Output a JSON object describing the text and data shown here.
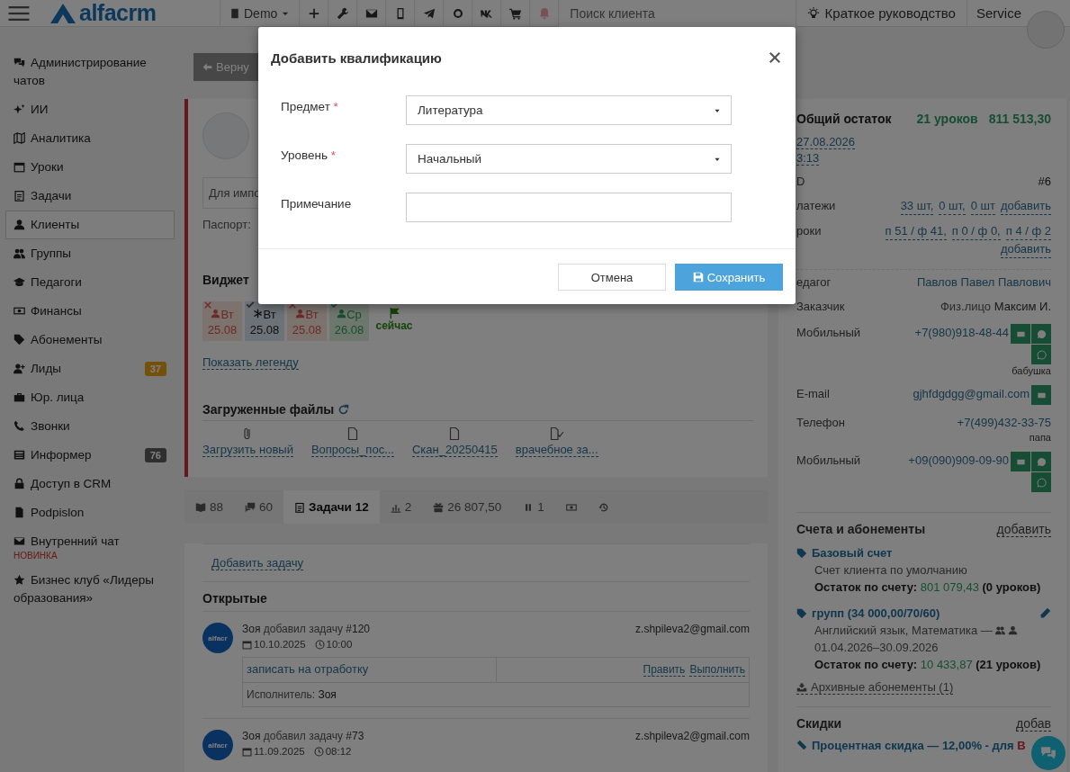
{
  "topbar": {
    "logo": "alfacrm",
    "branch": "Demo",
    "search_placeholder": "Поиск клиента",
    "guide": "Краткое руководство",
    "user": "Service"
  },
  "sidebar": [
    {
      "label": "Администрирование чатов",
      "selected": false
    },
    {
      "label": "ИИ",
      "selected": false
    },
    {
      "label": "Аналитика",
      "selected": false
    },
    {
      "label": "Уроки",
      "selected": false
    },
    {
      "label": "Задачи",
      "selected": false
    },
    {
      "label": "Клиенты",
      "selected": true
    },
    {
      "label": "Группы",
      "selected": false
    },
    {
      "label": "Педагоги",
      "selected": false
    },
    {
      "label": "Финансы",
      "selected": false
    },
    {
      "label": "Абонементы",
      "selected": false
    },
    {
      "label": "Лиды",
      "selected": false,
      "badge": {
        "text": "37",
        "kind": "warning"
      }
    },
    {
      "label": "Юр. лица",
      "selected": false
    },
    {
      "label": "Звонки",
      "selected": false
    },
    {
      "label": "Информер",
      "selected": false,
      "badge": {
        "text": "76",
        "kind": "default"
      }
    },
    {
      "label": "Доступ в CRM",
      "selected": false
    },
    {
      "label": "Podpislon",
      "selected": false
    },
    {
      "label": "Внутренний чат",
      "selected": false,
      "note": "НОВИНКА"
    },
    {
      "label": "Бизнес клуб «Лидеры образования»",
      "selected": false
    }
  ],
  "back_button": "Верну",
  "client_card": {
    "note_fragment": "Для импо",
    "passport_fragment": "Паспорт:",
    "widget_title_fragment": "Виджет",
    "lessons": [
      {
        "kind": "cancelled",
        "day": "Вт",
        "date": "25.08"
      },
      {
        "kind": "planned",
        "day": "Вт",
        "date": "25.08"
      },
      {
        "kind": "cancelled",
        "day": "Вт",
        "date": "25.08"
      },
      {
        "kind": "attended",
        "day": "Ср",
        "date": "26.08"
      }
    ],
    "now_label": "сейчас",
    "legend_link": "Показать легенду",
    "files_title": "Загруженные файлы",
    "files": [
      {
        "kind": "upload",
        "name": "Загрузить новый"
      },
      {
        "kind": "file",
        "name": "Вопросы_пос..."
      },
      {
        "kind": "file",
        "name": "Скан_20250415"
      },
      {
        "kind": "signed",
        "name": "врачебное за..."
      }
    ]
  },
  "tabs": [
    {
      "kind": "book",
      "label": "88",
      "selected": false
    },
    {
      "kind": "comments",
      "label": "60",
      "selected": false
    },
    {
      "kind": "tasks",
      "label": "Задачи 12",
      "selected": true
    },
    {
      "kind": "chart",
      "label": "2",
      "selected": false
    },
    {
      "kind": "gift",
      "label": "26 807,50",
      "selected": false
    },
    {
      "kind": "pause",
      "label": "1",
      "selected": false
    },
    {
      "kind": "money",
      "selected": false
    },
    {
      "kind": "history",
      "selected": false
    }
  ],
  "tasks": {
    "add_link": "Добавить задачу",
    "open_title": "Открытые",
    "items": [
      {
        "avatar_label": "alfacr",
        "author": "Зоя",
        "action": "добавил задачу",
        "number": "#120",
        "email": "z.shpileva2@gmail.com",
        "date": "10.10.2025",
        "time": "10:00",
        "text": "записать на отработку",
        "edit": "Править",
        "complete": "Выполнить",
        "assignee_label": "Исполнитель:",
        "assignee": "Зоя"
      },
      {
        "avatar_label": "alfacr",
        "author": "Зоя",
        "action": "добавил задачу",
        "number": "#73",
        "email": "z.shpileva2@gmail.com",
        "date": "11.09.2025",
        "time": "08:12"
      }
    ]
  },
  "summary": {
    "title": "Общий остаток",
    "lessons": "21 уроков",
    "amount": "811 513,30",
    "date": "27.08.2026",
    "time": "3:13"
  },
  "fields": [
    {
      "kind": "plain",
      "label": "D",
      "value": "#6"
    },
    {
      "kind": "links",
      "label": "латежи",
      "links": [
        "33 шт,",
        "0 шт,",
        "0 шт"
      ],
      "add": "добавить"
    },
    {
      "kind": "links",
      "label": "роки",
      "links": [
        "п 51 / ф 41,",
        "п 0 / ф 0,",
        "п 4 / ф 2"
      ],
      "add": "добавить"
    },
    {
      "kind": "divider"
    },
    {
      "kind": "link",
      "label": "едагог",
      "value": "Павлов Павел Павлович"
    },
    {
      "kind": "customer",
      "label": "Заказчик",
      "prefix": "Физ.лицо",
      "value": "Максим И."
    },
    {
      "kind": "mobile",
      "label": "Мобильный",
      "value": "+7(980)918-48-44",
      "note": "бабушка"
    },
    {
      "kind": "email",
      "label": "E-mail",
      "value": "gjhfdgdgg@gmail.com"
    },
    {
      "kind": "phone",
      "label": "Телефон",
      "value": "+7(499)432-33-75",
      "note": "папа"
    },
    {
      "kind": "mobile",
      "label": "Мобильный",
      "value": "+09(090)909-09-90"
    }
  ],
  "accounts": {
    "title": "Счета и абонементы",
    "add": "добавить",
    "items": [
      {
        "name": "Базовый счет",
        "desc": "Счет клиента по умолчанию",
        "balance_label": "Остаток по счету:",
        "balance": "801 079,43",
        "lessons": "(0 уроков)",
        "editable": false
      },
      {
        "name": "групп (34 000,00/70/60)",
        "desc": "Английский язык, Математика —",
        "period": "01.04.2026–30.09.2026",
        "balance_label": "Остаток по счету:",
        "balance": "10 433,87",
        "lessons": "(21 уроков)",
        "editable": true
      }
    ],
    "archive": "Архивные абонементы (1)"
  },
  "discounts": {
    "title": "Скидки",
    "add": "добав",
    "item": "Процентная скидка — 12,00% - для",
    "scope": "В"
  },
  "modal": {
    "title": "Добавить квалификацию",
    "required_mark": "*",
    "fields": [
      {
        "kind": "select",
        "label": "Предмет",
        "required": true,
        "value": "Литература"
      },
      {
        "kind": "select",
        "label": "Уровень",
        "required": true,
        "value": "Начальный"
      },
      {
        "kind": "text",
        "label": "Примечание",
        "required": false
      }
    ],
    "cancel": "Отмена",
    "save": "Сохранить"
  }
}
